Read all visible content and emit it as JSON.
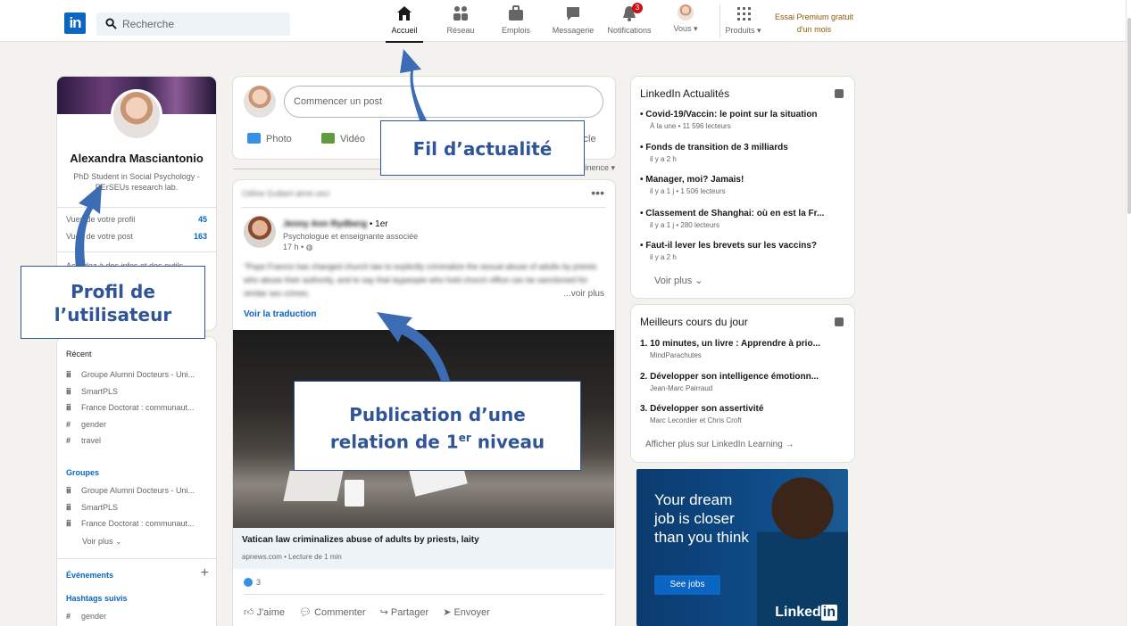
{
  "topbar": {
    "logo": "in",
    "search_placeholder": "Recherche",
    "nav": [
      {
        "label": "Accueil",
        "icon": "home-icon"
      },
      {
        "label": "Réseau",
        "icon": "network-icon"
      },
      {
        "label": "Emplois",
        "icon": "briefcase-icon"
      },
      {
        "label": "Messagerie",
        "icon": "message-icon"
      },
      {
        "label": "Notifications",
        "icon": "bell-icon",
        "badge": "3"
      },
      {
        "label": "Vous ▾",
        "icon": "avatar"
      },
      {
        "label": "Produits ▾",
        "icon": "grid-icon"
      }
    ],
    "premium_line1": "Essai Premium gratuit",
    "premium_line2": "d'un mois"
  },
  "profile": {
    "name": "Alexandra Masciantonio",
    "headline": "PhD Student in Social Psychology - PErSEUs research lab.",
    "stats": [
      {
        "label": "Vues de votre profil",
        "value": "45"
      },
      {
        "label": "Vues de votre post",
        "value": "163"
      }
    ],
    "tools_text": "Accédez à des infos et des outils"
  },
  "recent": {
    "title": "Récent",
    "items": [
      "Groupe Alumni Docteurs - Uni...",
      "SmartPLS",
      "France Doctorat : communaut...",
      "gender",
      "travel"
    ],
    "icons": [
      "group-icon",
      "group-icon",
      "group-icon",
      "hashtag-icon",
      "hashtag-icon"
    ]
  },
  "groups": {
    "title": "Groupes",
    "items": [
      "Groupe Alumni Docteurs - Uni...",
      "SmartPLS",
      "France Doctorat : communaut..."
    ],
    "see_more": "Voir plus"
  },
  "events": {
    "title": "Événements"
  },
  "hashtags": {
    "title": "Hashtags suivis",
    "items": [
      "gender"
    ]
  },
  "composer": {
    "placeholder": "Commencer un post",
    "actions": [
      {
        "label": "Photo",
        "color": "#378fe9"
      },
      {
        "label": "Vidéo",
        "color": "#5f9b41"
      },
      {
        "label": "Article",
        "color": "#e16745"
      }
    ],
    "sort_label": "Trier par : Pertinence"
  },
  "post": {
    "liker_line": "Céline Guibert aime ceci",
    "author": "Jenny Ann Rydberg",
    "degree": "• 1er",
    "subtitle": "Psychologue et enseignante associée",
    "time": "17 h •",
    "body": "\"Pope Francis has changed church law to explicitly criminalize the sexual abuse of adults by priests who abuse their authority, and to say that laypeople who hold church office can be sanctioned for similar sex crimes.",
    "see_more": "...voir plus",
    "translate": "Voir la traduction",
    "article_title": "Vatican law criminalizes abuse of adults by priests, laity",
    "article_source": "apnews.com • Lecture de 1 min",
    "reactions": "3",
    "actions": [
      "J'aime",
      "Commenter",
      "Partager",
      "Envoyer"
    ]
  },
  "news": {
    "title": "LinkedIn Actualités",
    "items": [
      {
        "title": "Covid-19/Vaccin: le point sur la situation",
        "sub": "À la une • 11 596 lecteurs"
      },
      {
        "title": "Fonds de transition de 3 milliards",
        "sub": "il y a 2 h"
      },
      {
        "title": "Manager, moi? Jamais!",
        "sub": "il y a 1 j • 1 506 lecteurs"
      },
      {
        "title": "Classement de Shanghai: où en est la Fr...",
        "sub": "il y a 1 j • 280 lecteurs"
      },
      {
        "title": "Faut-il lever les brevets sur les vaccins?",
        "sub": "il y a 2 h"
      }
    ],
    "see_more": "Voir plus"
  },
  "courses": {
    "title": "Meilleurs cours du jour",
    "items": [
      {
        "title": "1. 10 minutes, un livre : Apprendre à prio...",
        "sub": "MindParachutes"
      },
      {
        "title": "2. Développer son intelligence émotionn...",
        "sub": "Jean-Marc Pairraud"
      },
      {
        "title": "3. Développer son assertivité",
        "sub": "Marc Lecordier et Chris Croft"
      }
    ],
    "see_more": "Afficher plus sur LinkedIn Learning →"
  },
  "ad": {
    "text": "Your dream job is closer than you think",
    "button": "See jobs",
    "brand": "Linked",
    "brand_in": "in"
  },
  "annotations": {
    "feed": "Fil d’actualité",
    "profile_line1": "Profil de",
    "profile_line2": "l’utilisateur",
    "post_line1": "Publication d’une",
    "post_line2": "relation de 1",
    "post_sup": "er",
    "post_line2_end": " niveau",
    "arrow_color": "#3c6cb4"
  }
}
